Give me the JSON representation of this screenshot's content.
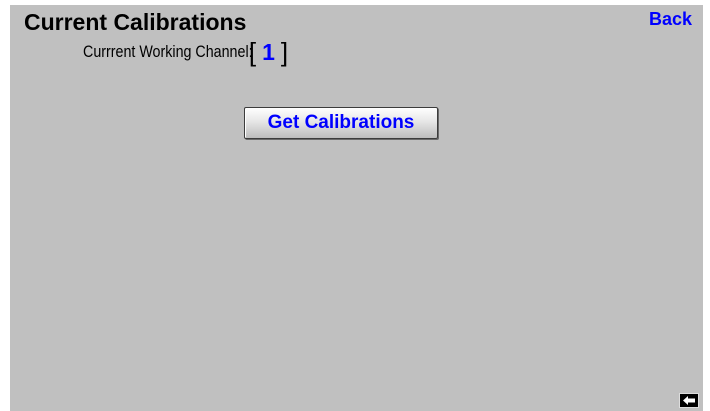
{
  "header": {
    "title": "Current Calibrations",
    "back_label": "Back"
  },
  "channel": {
    "label": "Currrent Working Channel:",
    "open_bracket": "[",
    "value": "1",
    "close_bracket": "]"
  },
  "actions": {
    "get_calibrations_label": "Get Calibrations"
  },
  "icons": {
    "nav_back": "left-arrow-icon"
  },
  "colors": {
    "background": "#c0c0c0",
    "accent": "#0000ff"
  }
}
